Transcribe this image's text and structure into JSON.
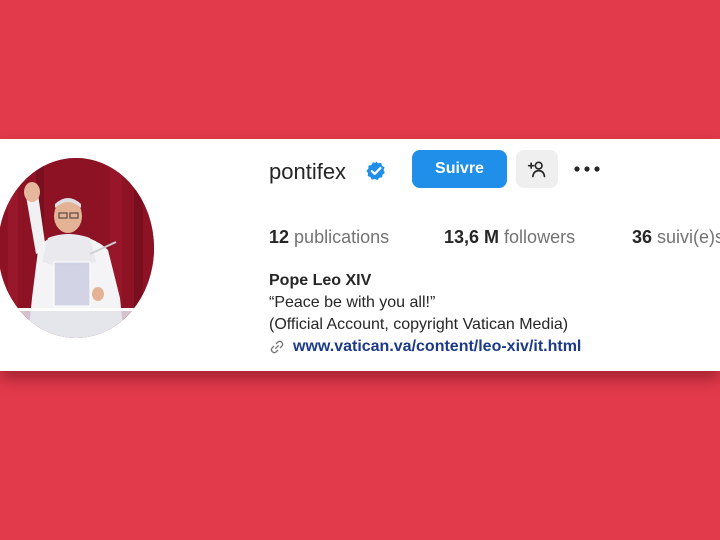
{
  "profile": {
    "username": "pontifex",
    "follow_label": "Suivre",
    "stats": {
      "posts_count": "12",
      "posts_label": "publications",
      "followers_count": "13,6 M",
      "followers_label": "followers",
      "following_count": "36",
      "following_label": "suivi(e)s"
    },
    "bio": {
      "name": "Pope Leo XIV",
      "line1": "“Peace be with you all!”",
      "line2": "(Official Account, copyright Vatican Media)",
      "link": "www.vatican.va/content/leo-xiv/it.html"
    }
  },
  "icons": {
    "verified": "verified-badge-icon",
    "add_user": "add-user-icon",
    "more": "more-options-icon",
    "link": "link-icon"
  },
  "colors": {
    "background": "#e23a4b",
    "follow_button": "#1f8fea",
    "verified_badge": "#1f8fea",
    "link": "#1b3a8a"
  }
}
